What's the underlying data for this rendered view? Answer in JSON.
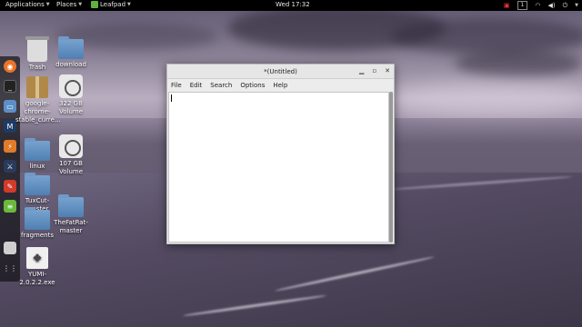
{
  "top_panel": {
    "applications_label": "Applications",
    "places_label": "Places",
    "active_app_label": "Leafpad",
    "clock": "Wed 17:32",
    "workspace_number": "1",
    "tray_icons": [
      "display-icon",
      "wifi-icon",
      "volume-icon",
      "power-icon"
    ]
  },
  "dock": {
    "items": [
      "firefox-icon",
      "terminal-icon",
      "files-icon",
      "metasploit-icon",
      "burpsuite-icon",
      "kali-icon",
      "maltego-icon",
      "leafpad-icon",
      "document-icon",
      "show-apps-icon"
    ]
  },
  "desktop": {
    "icons": [
      {
        "label": "Trash",
        "icon": "trash-icon"
      },
      {
        "label": "download",
        "icon": "folder-icon"
      },
      {
        "label": "google-chrome-stable_curre...",
        "icon": "package-icon"
      },
      {
        "label": "322 GB Volume",
        "icon": "disk-icon"
      },
      {
        "label": "linux",
        "icon": "folder-icon"
      },
      {
        "label": "107 GB Volume",
        "icon": "disk-icon"
      },
      {
        "label": "TuxCut-master",
        "icon": "folder-icon"
      },
      {
        "label": "fragments",
        "icon": "folder-icon"
      },
      {
        "label": "TheFatRat-master",
        "icon": "folder-icon"
      },
      {
        "label": "YUMI-2.0.2.2.exe",
        "icon": "exe-icon"
      }
    ]
  },
  "window": {
    "title": "*(Untitled)",
    "controls": {
      "minimize": "▁",
      "maximize": "▫",
      "close": "✕"
    },
    "menu": [
      "File",
      "Edit",
      "Search",
      "Options",
      "Help"
    ],
    "content": ""
  }
}
